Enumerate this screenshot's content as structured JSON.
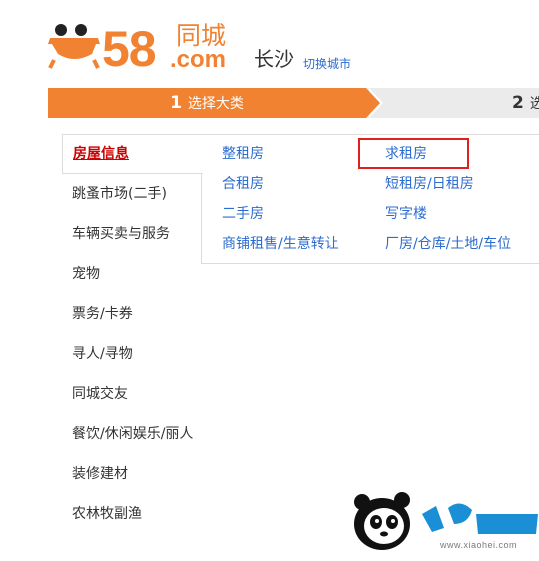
{
  "header": {
    "logo_number": "58",
    "logo_tongcheng": "同城",
    "logo_com": ".com",
    "city": "长沙",
    "switch_city": "切换城市"
  },
  "steps": [
    {
      "num": "1",
      "label": "选择大类"
    },
    {
      "num": "2",
      "label": "选"
    }
  ],
  "categories": [
    {
      "label": "房屋信息"
    },
    {
      "label": "跳蚤市场(二手)"
    },
    {
      "label": "车辆买卖与服务"
    },
    {
      "label": "宠物"
    },
    {
      "label": "票务/卡券"
    },
    {
      "label": "寻人/寻物"
    },
    {
      "label": "同城交友"
    },
    {
      "label": "餐饮/休闲娱乐/丽人"
    },
    {
      "label": "装修建材"
    },
    {
      "label": "农林牧副渔"
    }
  ],
  "subcategories": [
    {
      "label": "整租房"
    },
    {
      "label": "求租房"
    },
    {
      "label": "合租房"
    },
    {
      "label": "短租房/日租房"
    },
    {
      "label": "二手房"
    },
    {
      "label": "写字楼"
    },
    {
      "label": "商铺租售/生意转让"
    },
    {
      "label": "厂房/仓库/土地/车位"
    }
  ],
  "watermark": {
    "url": "www.xiaohei.com"
  },
  "colors": {
    "brand_orange": "#f08232",
    "link_blue": "#2b6ccf",
    "active_red": "#cc0000",
    "highlight_red": "#e0201c"
  }
}
